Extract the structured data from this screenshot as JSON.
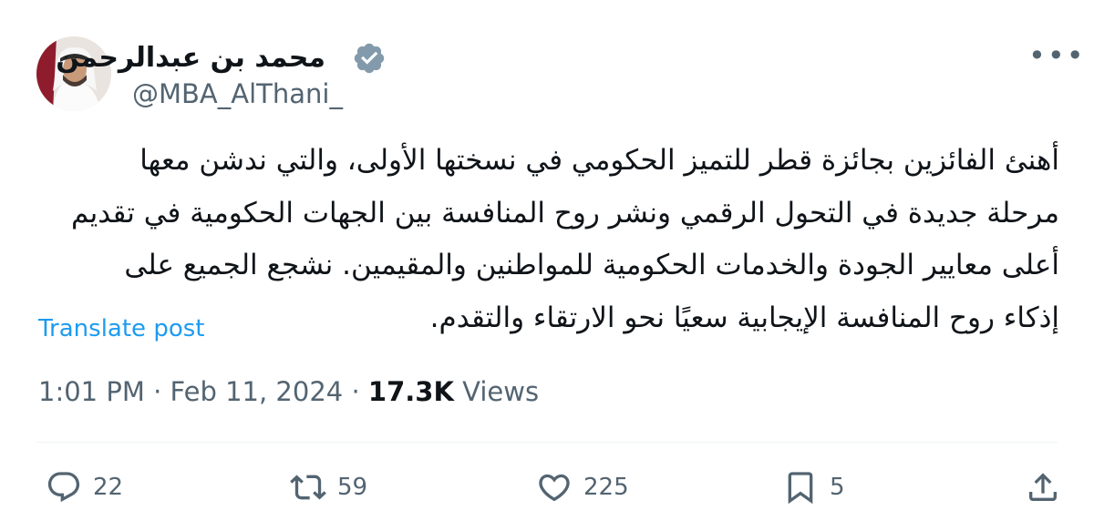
{
  "tweet": {
    "display_name": "محمد بن عبدالرحمن",
    "handle": "@MBA_AlThani_",
    "text_lines": [
      "أهنئ الفائزين بجائزة قطر للتميز الحكومي في نسختها الأولى، والتي ندشن معها",
      "مرحلة جديدة في التحول الرقمي ونشر روح المنافسة بين الجهات الحكومية في تقديم",
      "أعلى معايير الجودة والخدمات الحكومية للمواطنين والمقيمين. نشجع الجميع على",
      "إذكاء روح المنافسة الإيجابية سعيًا نحو الارتقاء والتقدم."
    ],
    "translate_label": "Translate post",
    "time": "1:01 PM",
    "date": "Feb 11, 2024",
    "views_count": "17.3K",
    "views_label": "Views",
    "separator": "·"
  },
  "actions": {
    "replies": "22",
    "reposts": "59",
    "likes": "225",
    "bookmarks": "5"
  },
  "icons": {
    "verified": "verified-badge-icon",
    "more": "more-icon",
    "reply": "reply-icon",
    "repost": "repost-icon",
    "like": "like-icon",
    "bookmark": "bookmark-icon",
    "share": "share-icon"
  },
  "colors": {
    "text": "#0f1419",
    "secondary": "#536471",
    "link": "#1d9bf0",
    "verified": "#829aab"
  }
}
